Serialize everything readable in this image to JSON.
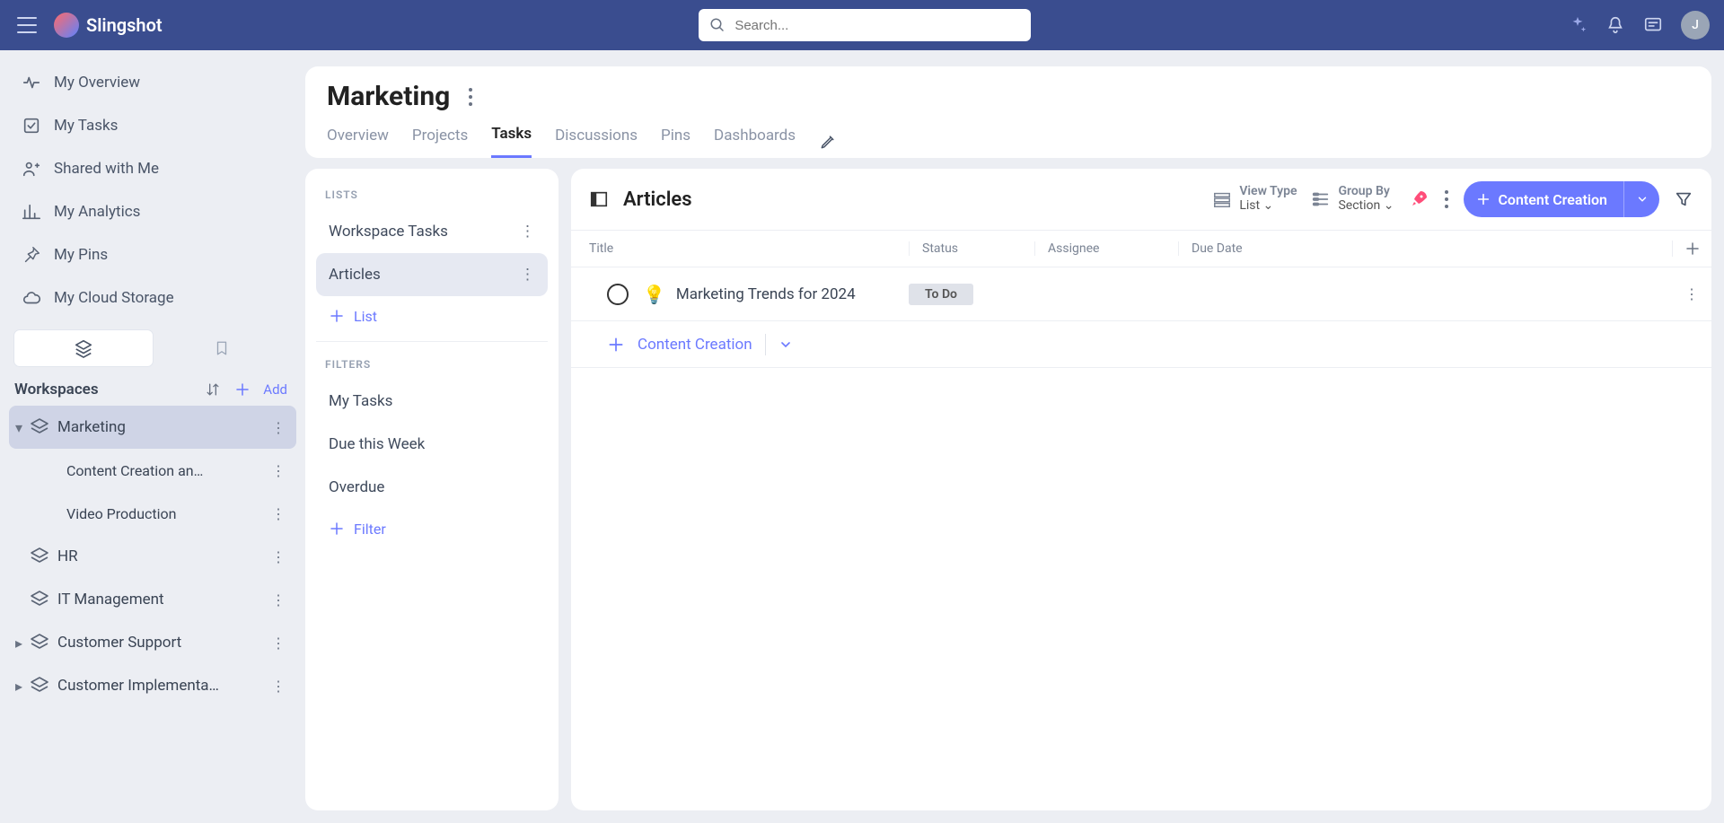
{
  "brand": "Slingshot",
  "search": {
    "placeholder": "Search..."
  },
  "avatar_initial": "J",
  "sidebar": {
    "nav": [
      {
        "label": "My Overview"
      },
      {
        "label": "My Tasks"
      },
      {
        "label": "Shared with Me"
      },
      {
        "label": "My Analytics"
      },
      {
        "label": "My Pins"
      },
      {
        "label": "My Cloud Storage"
      }
    ],
    "workspaces_label": "Workspaces",
    "add_label": "Add",
    "tree": [
      {
        "label": "Marketing",
        "expanded": true,
        "selected": true,
        "children": [
          {
            "label": "Content Creation an…"
          },
          {
            "label": "Video Production"
          }
        ]
      },
      {
        "label": "HR"
      },
      {
        "label": "IT Management"
      },
      {
        "label": "Customer Support",
        "caret": true
      },
      {
        "label": "Customer Implementa…",
        "caret": true
      }
    ]
  },
  "page": {
    "title": "Marketing",
    "tabs": [
      "Overview",
      "Projects",
      "Tasks",
      "Discussions",
      "Pins",
      "Dashboards"
    ],
    "active_tab": "Tasks"
  },
  "lists_panel": {
    "lists_header": "LISTS",
    "lists": [
      {
        "label": "Workspace Tasks"
      },
      {
        "label": "Articles",
        "active": true
      }
    ],
    "add_list_label": "List",
    "filters_header": "FILTERS",
    "filters": [
      {
        "label": "My Tasks"
      },
      {
        "label": "Due this Week"
      },
      {
        "label": "Overdue"
      }
    ],
    "add_filter_label": "Filter"
  },
  "tasks_panel": {
    "title": "Articles",
    "view_type_label": "View Type",
    "view_type_value": "List",
    "group_by_label": "Group By",
    "group_by_value": "Section",
    "primary_button": "Content Creation",
    "columns": {
      "title": "Title",
      "status": "Status",
      "assignee": "Assignee",
      "due": "Due Date"
    },
    "rows": [
      {
        "emoji": "💡",
        "name": "Marketing Trends for 2024",
        "status": "To Do"
      }
    ],
    "add_row_label": "Content Creation"
  }
}
